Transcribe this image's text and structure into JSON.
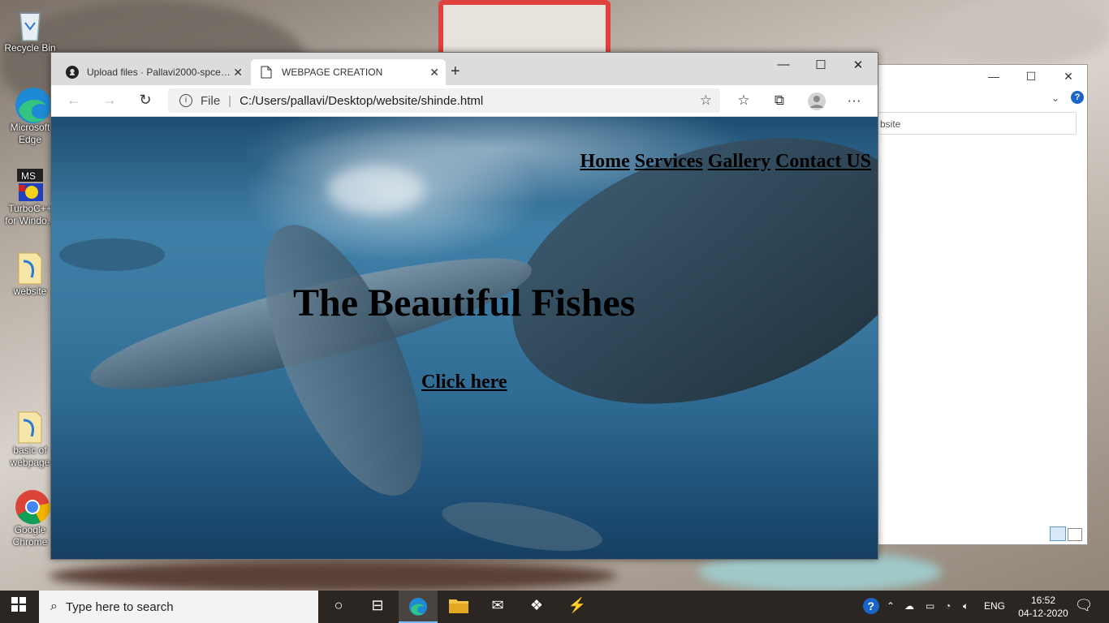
{
  "desktop": {
    "icons": [
      {
        "label": "Recycle Bin",
        "icon": "recycle-bin-icon"
      },
      {
        "label": "Microsoft Edge",
        "icon": "edge-icon"
      },
      {
        "label": "TurboC++ for Windo...",
        "icon": "turboc-icon"
      },
      {
        "label": "website",
        "icon": "folder-icon"
      },
      {
        "label": "basic of webpage",
        "icon": "folder-icon"
      },
      {
        "label": "Google Chrome",
        "icon": "chrome-icon"
      }
    ]
  },
  "explorer": {
    "address_fragment": "bsite"
  },
  "browser": {
    "tabs": [
      {
        "title": "Upload files · Pallavi2000-spce/P...",
        "icon": "github-icon",
        "active": false
      },
      {
        "title": "WEBPAGE CREATION",
        "icon": "page-icon",
        "active": true
      }
    ],
    "address": {
      "scheme_label": "File",
      "url": "C:/Users/pallavi/Desktop/website/shinde.html"
    },
    "window_controls": {
      "minimize": "—",
      "maximize": "☐",
      "close": "✕"
    }
  },
  "webpage": {
    "nav": [
      "Home",
      "Services",
      "Gallery",
      "Contact US"
    ],
    "headline": "The Beautiful Fishes",
    "cta": "Click here"
  },
  "taskbar": {
    "search_placeholder": "Type here to search",
    "language": "ENG",
    "time": "16:52",
    "date": "04-12-2020"
  }
}
